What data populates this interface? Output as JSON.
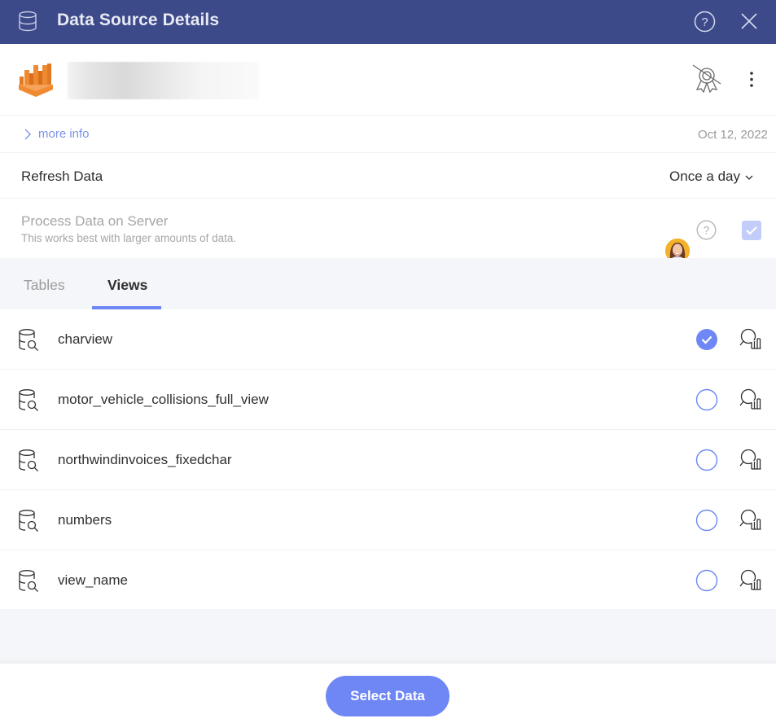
{
  "header": {
    "title": "Data Source Details",
    "icon": "database-icon",
    "help_icon": "help-circle-icon",
    "close_icon": "close-icon"
  },
  "source": {
    "logo": "aws-athena-logo",
    "name": "",
    "certification_icon": "certification-off-icon",
    "more_icon": "more-vertical-icon"
  },
  "info": {
    "more_info_label": "more info",
    "date": "Oct 12, 2022"
  },
  "refresh": {
    "label": "Refresh Data",
    "value": "Once a day"
  },
  "process": {
    "label": "Process Data on Server",
    "description": "This works best with larger amounts of data.",
    "checked": true
  },
  "tabs": [
    {
      "label": "Tables",
      "active": false
    },
    {
      "label": "Views",
      "active": true
    }
  ],
  "views": [
    {
      "name": "charview",
      "selected": true
    },
    {
      "name": "motor_vehicle_collisions_full_view",
      "selected": false
    },
    {
      "name": "northwindinvoices_fixedchar",
      "selected": false
    },
    {
      "name": "numbers",
      "selected": false
    },
    {
      "name": "view_name",
      "selected": false
    }
  ],
  "footer": {
    "select_label": "Select Data"
  },
  "colors": {
    "header_bg": "#3d4a8a",
    "accent": "#6e87f5",
    "link": "#7d93ec"
  }
}
